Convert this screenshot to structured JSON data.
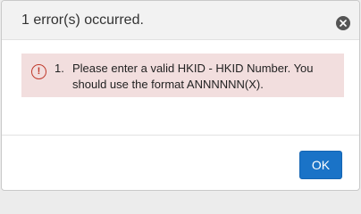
{
  "dialog": {
    "title": "1 error(s) occurred.",
    "close_icon": "close-icon",
    "alert": {
      "icon": "error-circle-icon",
      "icon_glyph": "!",
      "errors": [
        {
          "number": "1.",
          "text": "Please enter a valid HKID - HKID Number. You should use the format ANNNNNN(X)."
        }
      ]
    },
    "ok_label": "OK"
  },
  "colors": {
    "header_bg": "#f2f2f2",
    "alert_bg": "#f2dede",
    "error_icon": "#c0392b",
    "primary_button": "#1a73c7"
  }
}
